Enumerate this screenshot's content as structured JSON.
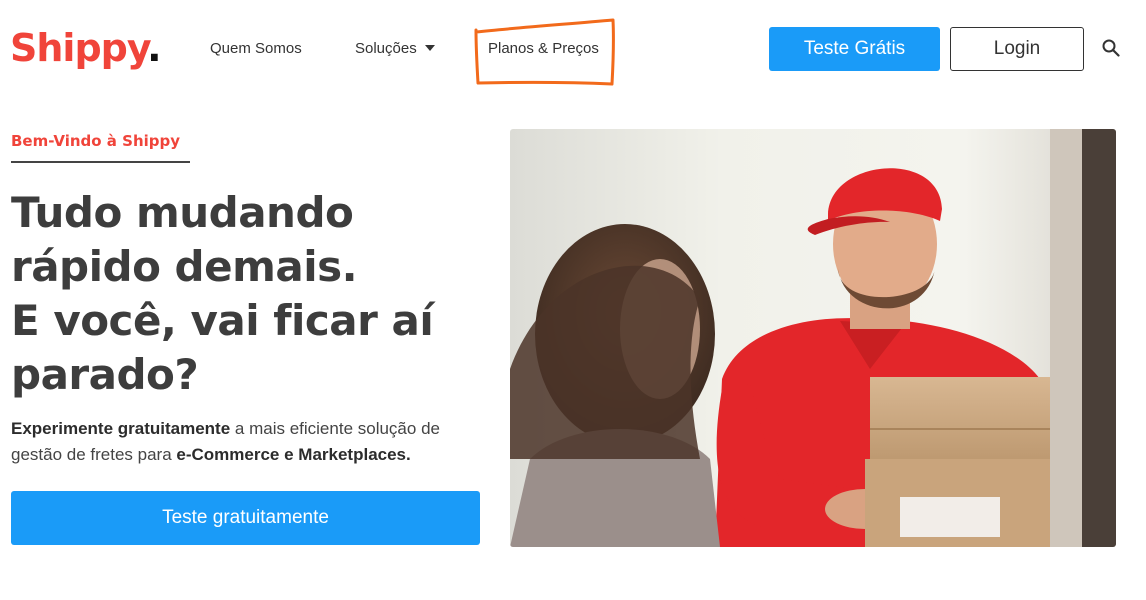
{
  "brand": {
    "name": "Shippy",
    "dot": ".",
    "color": "#f0443a"
  },
  "nav": {
    "quem_somos": "Quem Somos",
    "solucoes": "Soluções",
    "planos": "Planos & Preços"
  },
  "header_actions": {
    "trial_label": "Teste Grátis",
    "login_label": "Login",
    "search_icon": "search-icon"
  },
  "hero": {
    "eyebrow": "Bem-Vindo à Shippy",
    "headline": [
      "Tudo mudando",
      "rápido demais.",
      "E você, vai ficar aí",
      "parado?"
    ],
    "lead": {
      "strong1": "Experimente gratuitamente",
      "text1": " a mais eficiente solução de gestão de fretes para ",
      "strong2": "e-Commerce e Marketplaces."
    },
    "cta_label": "Teste gratuitamente"
  },
  "colors": {
    "accent": "#1a9bf8",
    "brand_red": "#f0443a",
    "annotation": "#f26a1b"
  }
}
